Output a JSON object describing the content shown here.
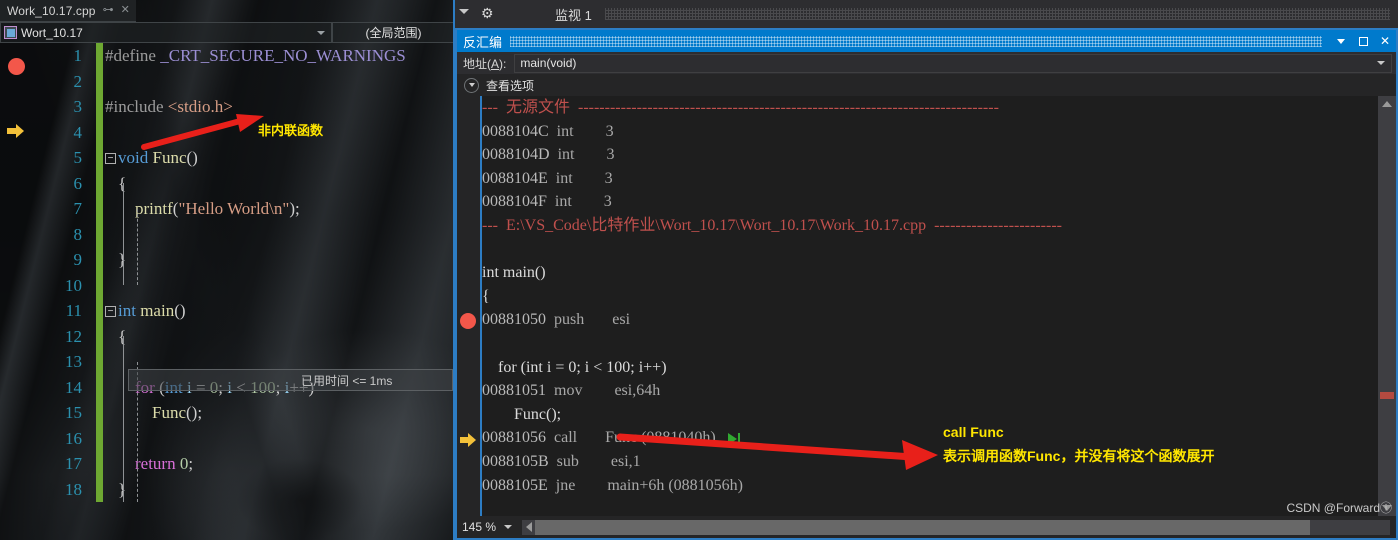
{
  "editor": {
    "tab": {
      "title": "Work_10.17.cpp",
      "pin_icon": "pin-icon",
      "close_icon": "close-icon"
    },
    "nav": {
      "project": "Wort_10.17",
      "scope": "(全局范围)"
    },
    "lines": [
      {
        "n": "1",
        "text": "#define _CRT_SECURE_NO_WARNINGS"
      },
      {
        "n": "2",
        "text": ""
      },
      {
        "n": "3",
        "text": "#include <stdio.h>"
      },
      {
        "n": "4",
        "text": ""
      },
      {
        "n": "5",
        "text": "void Func()"
      },
      {
        "n": "6",
        "text": "{"
      },
      {
        "n": "7",
        "text": "    printf(\"Hello World\\n\");"
      },
      {
        "n": "8",
        "text": ""
      },
      {
        "n": "9",
        "text": "}"
      },
      {
        "n": "10",
        "text": ""
      },
      {
        "n": "11",
        "text": "int main()"
      },
      {
        "n": "12",
        "text": "{"
      },
      {
        "n": "13",
        "text": ""
      },
      {
        "n": "14",
        "text": "    for (int i = 0; i < 100; i++)"
      },
      {
        "n": "15",
        "text": "        Func();"
      },
      {
        "n": "16",
        "text": ""
      },
      {
        "n": "17",
        "text": "    return 0;"
      },
      {
        "n": "18",
        "text": "}"
      }
    ],
    "breakpoint_line": "12",
    "current_line": "15",
    "elapsed_label": "已用时间 <= 1ms",
    "annotation": {
      "text": "非内联函数",
      "color": "#ffe600",
      "arrow_color": "#e8201a"
    }
  },
  "watch_panel": {
    "title": "监视 1",
    "caret_icon": "chevron-down-icon",
    "gear_icon": "gear-icon"
  },
  "disassembly": {
    "title": "反汇编",
    "window_buttons": {
      "dropdown": "chevron-down-icon",
      "restore": "restore-icon",
      "close": "close-icon"
    },
    "address_label": "地址(A):",
    "address_label_plain": "地址(",
    "address_label_accel": "A",
    "address_label_tail": "):",
    "address_value": "main(void)",
    "view_options": "查看选项",
    "lines": [
      {
        "kind": "sep",
        "text": "---  无源文件  -------------------------------------------------------------------------------"
      },
      {
        "kind": "asm",
        "addr": "0088104C",
        "mn": "int",
        "op": "3"
      },
      {
        "kind": "asm",
        "addr": "0088104D",
        "mn": "int",
        "op": "3"
      },
      {
        "kind": "asm",
        "addr": "0088104E",
        "mn": "int",
        "op": "3"
      },
      {
        "kind": "asm",
        "addr": "0088104F",
        "mn": "int",
        "op": "3"
      },
      {
        "kind": "sep",
        "text": "---  E:\\VS_Code\\比特作业\\Wort_10.17\\Wort_10.17\\Work_10.17.cpp  ------------------------"
      },
      {
        "kind": "blank",
        "text": ""
      },
      {
        "kind": "src",
        "text": "int main()"
      },
      {
        "kind": "src",
        "text": "{"
      },
      {
        "kind": "asm",
        "addr": "00881050",
        "mn": "push",
        "op": "esi",
        "marker": "breakpoint"
      },
      {
        "kind": "blank",
        "text": ""
      },
      {
        "kind": "src",
        "text": "    for (int i = 0; i < 100; i++)"
      },
      {
        "kind": "asm",
        "addr": "00881051",
        "mn": "mov",
        "op": "esi,64h"
      },
      {
        "kind": "src",
        "text": "        Func();"
      },
      {
        "kind": "asm",
        "addr": "00881056",
        "mn": "call",
        "op": "Func (0881040h)",
        "marker": "current",
        "run_to_cursor": "run-to-cursor-icon"
      },
      {
        "kind": "asm",
        "addr": "0088105B",
        "mn": "sub",
        "op": "esi,1"
      },
      {
        "kind": "asm",
        "addr": "0088105E",
        "mn": "jne",
        "op": "main+6h (0881056h)"
      }
    ],
    "annotation": {
      "line1": "call Func",
      "line2": "表示调用函数Func，并没有将这个函数展开",
      "color": "#ffe600",
      "arrow_color": "#e8201a"
    },
    "zoom": "145 %",
    "watermark": "CSDN @Forwardⓘ"
  },
  "colors": {
    "title_blue": "#007acc",
    "breakpoint_red": "#f3574a",
    "current_arrow_yellow": "#f3c13a",
    "annotation_yellow": "#ffe600",
    "annotation_red": "#e8201a",
    "sep_red": "#c0504d",
    "track_green": "#6ea832",
    "line_number_blue": "#2b91af"
  }
}
